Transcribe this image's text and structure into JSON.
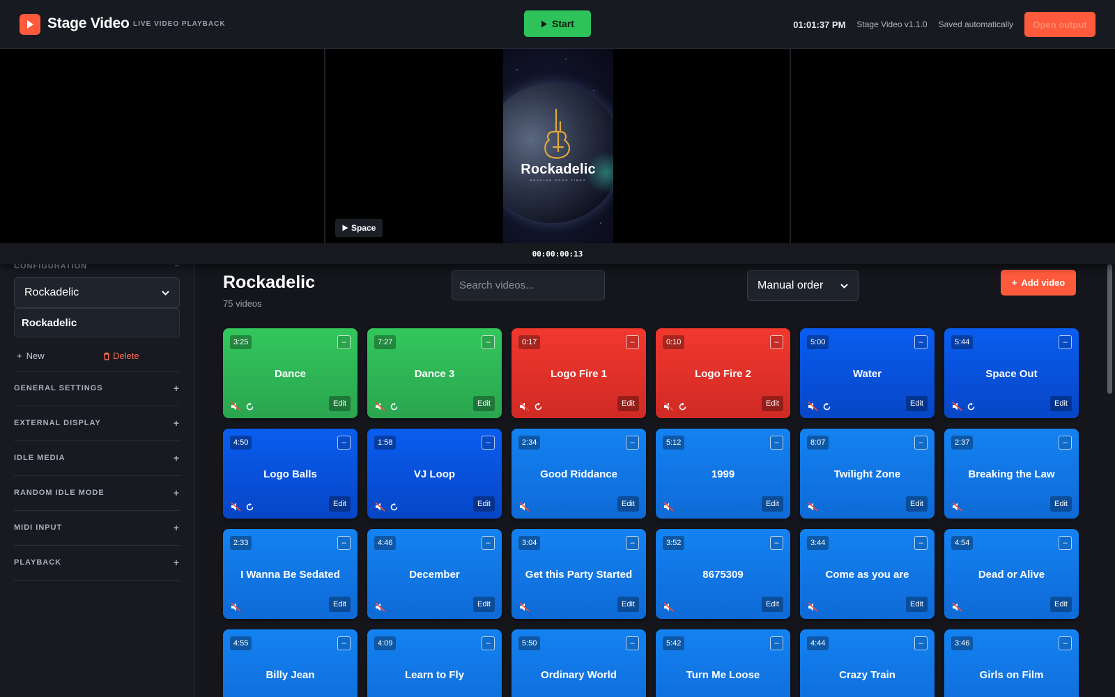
{
  "header": {
    "app_name": "Stage Video",
    "tagline": "LIVE VIDEO PLAYBACK",
    "start_label": "Start",
    "clock": "01:01:37 PM",
    "version": "Stage Video v1.1.0",
    "save_status": "Saved automatically",
    "open_output_label": "Open output"
  },
  "preview": {
    "thumb_title": "Rockadelic",
    "thumb_subtitle": "ROCKING GOOD TIMES",
    "space_label": "Space",
    "timecode": "00:00:00:13"
  },
  "sidebar": {
    "configuration_heading": "CONFIGURATION",
    "collapse_glyph": "−",
    "selected_config": "Rockadelic",
    "current_config_name": "Rockadelic",
    "new_label": "New",
    "delete_label": "Delete",
    "sections": [
      {
        "label": "GENERAL SETTINGS"
      },
      {
        "label": "EXTERNAL DISPLAY"
      },
      {
        "label": "IDLE MEDIA"
      },
      {
        "label": "RANDOM IDLE MODE"
      },
      {
        "label": "MIDI INPUT"
      },
      {
        "label": "PLAYBACK"
      }
    ]
  },
  "main": {
    "title": "Rockadelic",
    "count": "75 videos",
    "search_placeholder": "Search videos...",
    "sort_selected": "Manual order",
    "add_video_label": "Add video",
    "edit_label": "Edit",
    "remove_glyph": "–"
  },
  "colors": {
    "green": "#33c75c",
    "red": "#f2382e",
    "navy": "#0a5df0",
    "sky": "#1482f2",
    "accent": "#ff5a3c"
  },
  "videos": [
    {
      "duration": "3:25",
      "title": "Dance",
      "color": "green",
      "muted": true,
      "loop": true
    },
    {
      "duration": "7:27",
      "title": "Dance 3",
      "color": "green",
      "muted": true,
      "loop": true
    },
    {
      "duration": "0:17",
      "title": "Logo Fire 1",
      "color": "red",
      "muted": true,
      "loop": true
    },
    {
      "duration": "0:10",
      "title": "Logo Fire 2",
      "color": "red",
      "muted": true,
      "loop": true
    },
    {
      "duration": "5:00",
      "title": "Water",
      "color": "navy",
      "muted": true,
      "loop": true
    },
    {
      "duration": "5:44",
      "title": "Space Out",
      "color": "navy",
      "muted": true,
      "loop": true
    },
    {
      "duration": "4:50",
      "title": "Logo Balls",
      "color": "navy",
      "muted": true,
      "loop": true
    },
    {
      "duration": "1:58",
      "title": "VJ Loop",
      "color": "navy",
      "muted": true,
      "loop": true
    },
    {
      "duration": "2:34",
      "title": "Good Riddance",
      "color": "sky",
      "muted": true,
      "loop": false
    },
    {
      "duration": "5:12",
      "title": "1999",
      "color": "sky",
      "muted": true,
      "loop": false
    },
    {
      "duration": "8:07",
      "title": "Twilight Zone",
      "color": "sky",
      "muted": true,
      "loop": false
    },
    {
      "duration": "2:37",
      "title": "Breaking the Law",
      "color": "sky",
      "muted": true,
      "loop": false
    },
    {
      "duration": "2:33",
      "title": "I Wanna Be Sedated",
      "color": "sky",
      "muted": true,
      "loop": false
    },
    {
      "duration": "4:46",
      "title": "December",
      "color": "sky",
      "muted": true,
      "loop": false
    },
    {
      "duration": "3:04",
      "title": "Get this Party Started",
      "color": "sky",
      "muted": true,
      "loop": false
    },
    {
      "duration": "3:52",
      "title": "8675309",
      "color": "sky",
      "muted": true,
      "loop": false
    },
    {
      "duration": "3:44",
      "title": "Come as you are",
      "color": "sky",
      "muted": true,
      "loop": false
    },
    {
      "duration": "4:54",
      "title": "Dead or Alive",
      "color": "sky",
      "muted": true,
      "loop": false
    },
    {
      "duration": "4:55",
      "title": "Billy Jean",
      "color": "sky",
      "muted": true,
      "loop": false
    },
    {
      "duration": "4:09",
      "title": "Learn to Fly",
      "color": "sky",
      "muted": true,
      "loop": false
    },
    {
      "duration": "5:50",
      "title": "Ordinary World",
      "color": "sky",
      "muted": true,
      "loop": false
    },
    {
      "duration": "5:42",
      "title": "Turn Me Loose",
      "color": "sky",
      "muted": true,
      "loop": false
    },
    {
      "duration": "4:44",
      "title": "Crazy Train",
      "color": "sky",
      "muted": true,
      "loop": false
    },
    {
      "duration": "3:46",
      "title": "Girls on Film",
      "color": "sky",
      "muted": true,
      "loop": false
    }
  ]
}
